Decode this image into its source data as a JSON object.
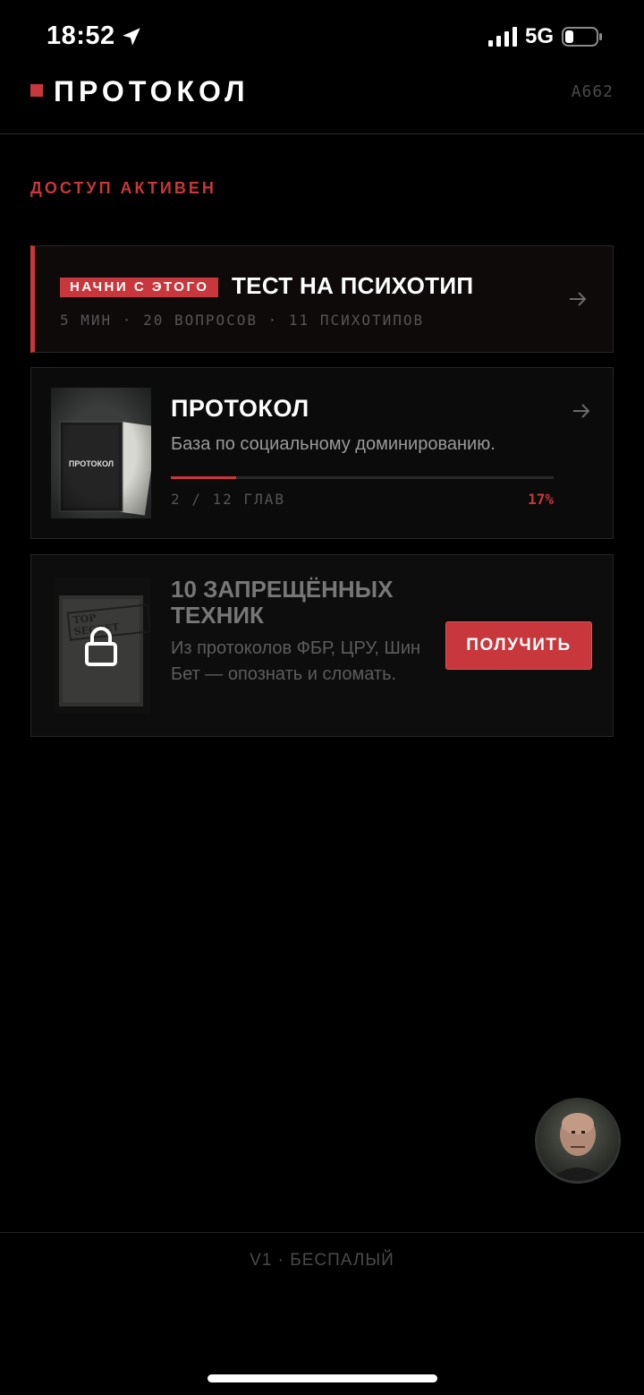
{
  "status_bar": {
    "time": "18:52",
    "network": "5G"
  },
  "header": {
    "brand": "ПРОТОКОЛ",
    "user_code": "A662"
  },
  "access": {
    "label": "ДОСТУП АКТИВЕН"
  },
  "test_card": {
    "badge": "НАЧНИ С ЭТОГО",
    "title": "ТЕСТ НА ПСИХОТИП",
    "meta": "5 МИН · 20 ВОПРОСОВ · 11 ПСИХОТИПОВ"
  },
  "book_card": {
    "cover_text": "ПРОТОКОЛ",
    "title": "ПРОТОКОЛ",
    "subtitle": "База по социальному доминированию.",
    "chapters": "2 / 12 ГЛАВ",
    "percent": "17%",
    "progress": 0.17
  },
  "locked_card": {
    "cover_stamp": "TOP SECRET",
    "title": "10 ЗАПРЕЩЁННЫХ ТЕХНИК",
    "description": "Из протоколов ФБР, ЦРУ, Шин Бет — опознать и сломать.",
    "button": "ПОЛУЧИТЬ"
  },
  "footer": {
    "text": "V1 · БЕСПАЛЫЙ"
  },
  "colors": {
    "accent": "#c8373b",
    "background": "#000000"
  }
}
